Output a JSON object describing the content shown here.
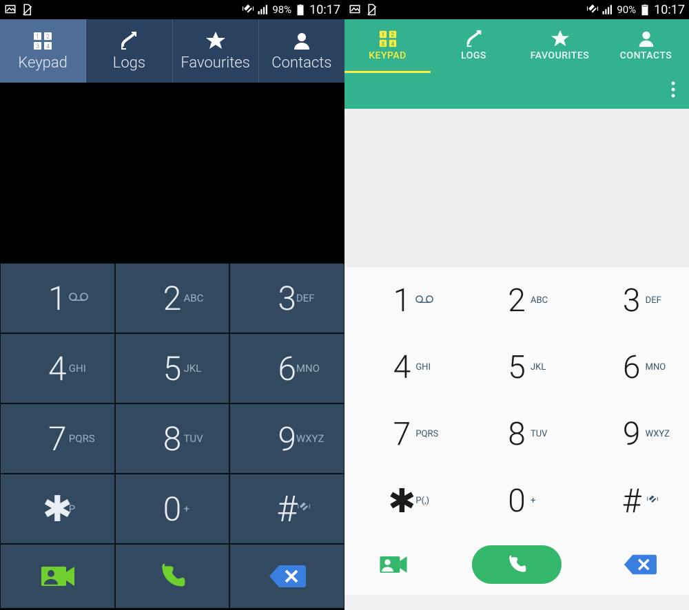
{
  "left": {
    "status": {
      "battery_pct": "98%",
      "time": "10:17"
    },
    "tabs": [
      {
        "label": "Keypad"
      },
      {
        "label": "Logs"
      },
      {
        "label": "Favourites"
      },
      {
        "label": "Contacts"
      }
    ],
    "keys": [
      {
        "n": "1",
        "l": ""
      },
      {
        "n": "2",
        "l": "ABC"
      },
      {
        "n": "3",
        "l": "DEF"
      },
      {
        "n": "4",
        "l": "GHI"
      },
      {
        "n": "5",
        "l": "JKL"
      },
      {
        "n": "6",
        "l": "MNO"
      },
      {
        "n": "7",
        "l": "PQRS"
      },
      {
        "n": "8",
        "l": "TUV"
      },
      {
        "n": "9",
        "l": "WXYZ"
      },
      {
        "sym": "✱",
        "l": "P"
      },
      {
        "n": "0",
        "l": "+"
      },
      {
        "sym": "#",
        "l": ""
      }
    ]
  },
  "right": {
    "status": {
      "battery_pct": "90%",
      "time": "10:17"
    },
    "tabs": [
      {
        "label": "KEYPAD"
      },
      {
        "label": "LOGS"
      },
      {
        "label": "FAVOURITES"
      },
      {
        "label": "CONTACTS"
      }
    ],
    "keys": [
      {
        "n": "1",
        "l": ""
      },
      {
        "n": "2",
        "l": "ABC"
      },
      {
        "n": "3",
        "l": "DEF"
      },
      {
        "n": "4",
        "l": "GHI"
      },
      {
        "n": "5",
        "l": "JKL"
      },
      {
        "n": "6",
        "l": "MNO"
      },
      {
        "n": "7",
        "l": "PQRS"
      },
      {
        "n": "8",
        "l": "TUV"
      },
      {
        "n": "9",
        "l": "WXYZ"
      },
      {
        "sym": "✱",
        "l": "P(,)"
      },
      {
        "n": "0",
        "l": "+"
      },
      {
        "sym": "#",
        "l": ""
      }
    ]
  }
}
